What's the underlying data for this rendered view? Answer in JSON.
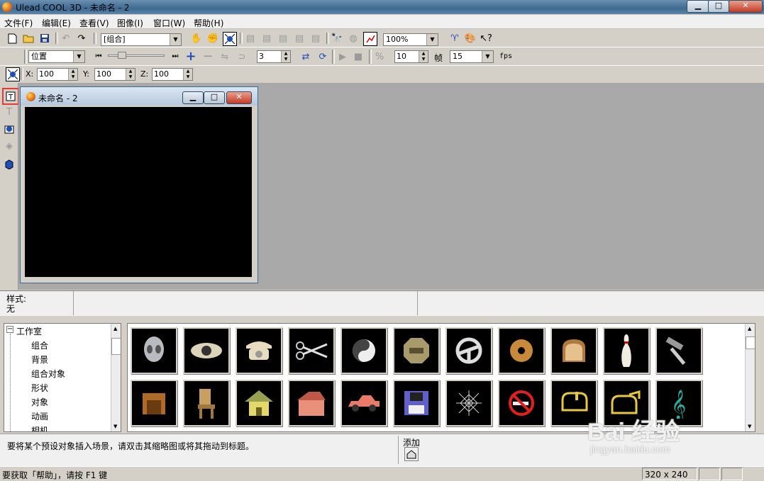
{
  "window": {
    "title": "Ulead COOL 3D - 未命名 - 2",
    "minimize": "▁",
    "maximize": "□",
    "close": "✕"
  },
  "menu": [
    "文件(F)",
    "编辑(E)",
    "查看(V)",
    "图像(I)",
    "窗口(W)",
    "帮助(H)"
  ],
  "toolbar1": {
    "object_combo": "[组合]",
    "zoom_combo": "100%",
    "icons": [
      "new-file-icon",
      "open-folder-icon",
      "save-icon",
      "undo-icon",
      "redo-icon"
    ]
  },
  "toolbar2": {
    "attribute_combo": "位置",
    "frame_value": "3",
    "frame_count": "10",
    "frame_label": "帧",
    "fps_value": "15",
    "fps_label": "fps"
  },
  "toolbar3": {
    "x_label": "X:",
    "x_value": "100",
    "y_label": "Y:",
    "y_value": "100",
    "z_label": "Z:",
    "z_value": "100"
  },
  "doc_window": {
    "title": "未命名 - 2"
  },
  "style_panel": {
    "label": "样式:",
    "value": "无"
  },
  "tree": {
    "root": "工作室",
    "items": [
      "组合",
      "背景",
      "组合对象",
      "形状",
      "对象",
      "动画",
      "相机"
    ]
  },
  "thumbnails": {
    "row1": [
      "alien-head",
      "eye",
      "telephone",
      "scissors",
      "yin-yang",
      "nut",
      "steering-wheel",
      "donut",
      "bread",
      "bowling-pin",
      "hammer"
    ],
    "row2": [
      "wooden-box",
      "chair",
      "house-yellow",
      "house-red",
      "car",
      "floppy-disk",
      "spider-web",
      "no-smoking",
      "mailbox",
      "mailbox-open",
      "treble-clef"
    ]
  },
  "hint": {
    "text": "要将某个预设对象插入场景，请双击其缩略图或将其拖动到标题。",
    "add_label": "添加"
  },
  "status": {
    "help_text": "要获取「帮助」，请按 F1 键",
    "size": "320 x 240"
  },
  "watermark": {
    "brand": "Bai 经验",
    "url": "jingyan.baidu.com"
  },
  "colors": {
    "canvas": "#000000",
    "workspace": "#a9a9a9",
    "highlight": "#e53935"
  }
}
